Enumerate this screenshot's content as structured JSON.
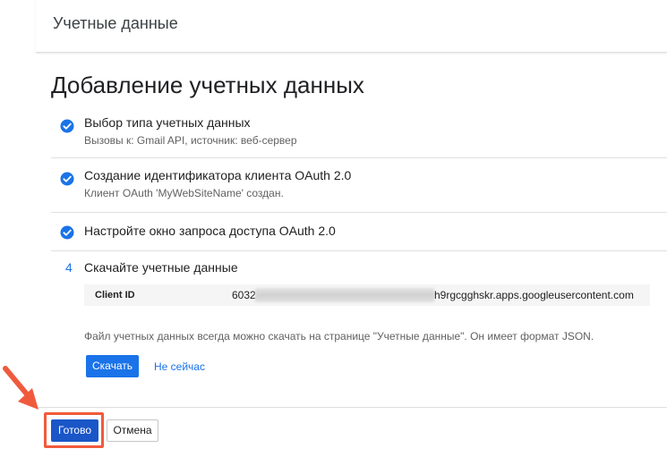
{
  "header": {
    "title": "Учетные данные"
  },
  "page": {
    "title": "Добавление учетных данных"
  },
  "steps": [
    {
      "title": "Выбор типа учетных данных",
      "subtitle": "Вызовы к: Gmail API, источник: веб-сервер",
      "status": "check-circle-icon"
    },
    {
      "title": "Создание идентификатора клиента OAuth 2.0",
      "subtitle": "Клиент OAuth 'MyWebSiteName' создан.",
      "status": "check-circle-icon"
    },
    {
      "title": "Настройте окно запроса доступа OAuth 2.0",
      "status": "check-circle-icon"
    }
  ],
  "step4": {
    "number": "4",
    "title": "Скачайте учетные данные",
    "client_id_label": "Client ID",
    "client_id_prefix": "6032",
    "client_id_suffix": "h9rgcgghskr.apps.googleusercontent.com",
    "note": "Файл учетных данных всегда можно скачать на странице \"Учетные данные\". Он имеет формат JSON.",
    "download_label": "Скачать",
    "later_label": "Не сейчас"
  },
  "footer": {
    "done_label": "Готово",
    "cancel_label": "Отмена"
  },
  "colors": {
    "accent": "#1a73e8",
    "highlight": "#f05a3c",
    "check": "#1a73e8"
  }
}
